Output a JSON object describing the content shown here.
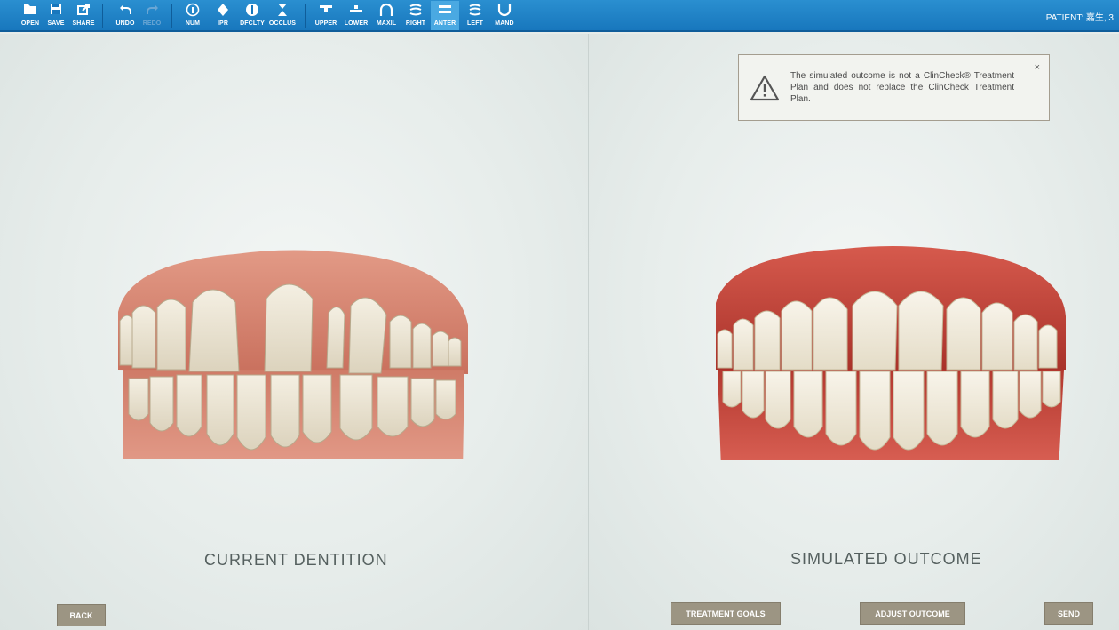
{
  "toolbar": {
    "buttons": [
      {
        "label": "OPEN",
        "icon": "folder-icon"
      },
      {
        "label": "SAVE",
        "icon": "save-icon"
      },
      {
        "label": "SHARE",
        "icon": "share-icon"
      },
      {
        "label": "UNDO",
        "icon": "undo-icon"
      },
      {
        "label": "REDO",
        "icon": "redo-icon",
        "disabled": true
      },
      {
        "label": "NUM",
        "icon": "number-icon"
      },
      {
        "label": "IPR",
        "icon": "ipr-diamond-icon"
      },
      {
        "label": "DFCLTY",
        "icon": "difficulty-icon"
      },
      {
        "label": "OCCLUS",
        "icon": "occlusion-icon"
      },
      {
        "label": "UPPER",
        "icon": "upper-view-icon"
      },
      {
        "label": "LOWER",
        "icon": "lower-view-icon"
      },
      {
        "label": "MAXIL",
        "icon": "maxillary-view-icon"
      },
      {
        "label": "RIGHT",
        "icon": "right-view-icon"
      },
      {
        "label": "ANTER",
        "icon": "anterior-view-icon",
        "active": true
      },
      {
        "label": "LEFT",
        "icon": "left-view-icon"
      },
      {
        "label": "MAND",
        "icon": "mandibular-view-icon"
      }
    ],
    "patient": "PATIENT: 嘉生, 3"
  },
  "left_panel": {
    "title": "CURRENT DENTITION"
  },
  "right_panel": {
    "title": "SIMULATED OUTCOME"
  },
  "notice": {
    "text": "The simulated outcome is not a ClinCheck® Treatment Plan and does not replace the ClinCheck Treatment Plan.",
    "close": "×"
  },
  "buttons": {
    "back": "BACK",
    "treatment_goals": "TREATMENT GOALS",
    "adjust_outcome": "ADJUST OUTCOME",
    "send": "SEND"
  },
  "colors": {
    "toolbar": "#1877bd",
    "button": "#9c9583",
    "gum_current": "#d98a76",
    "gum_simulated": "#c94a3f"
  }
}
